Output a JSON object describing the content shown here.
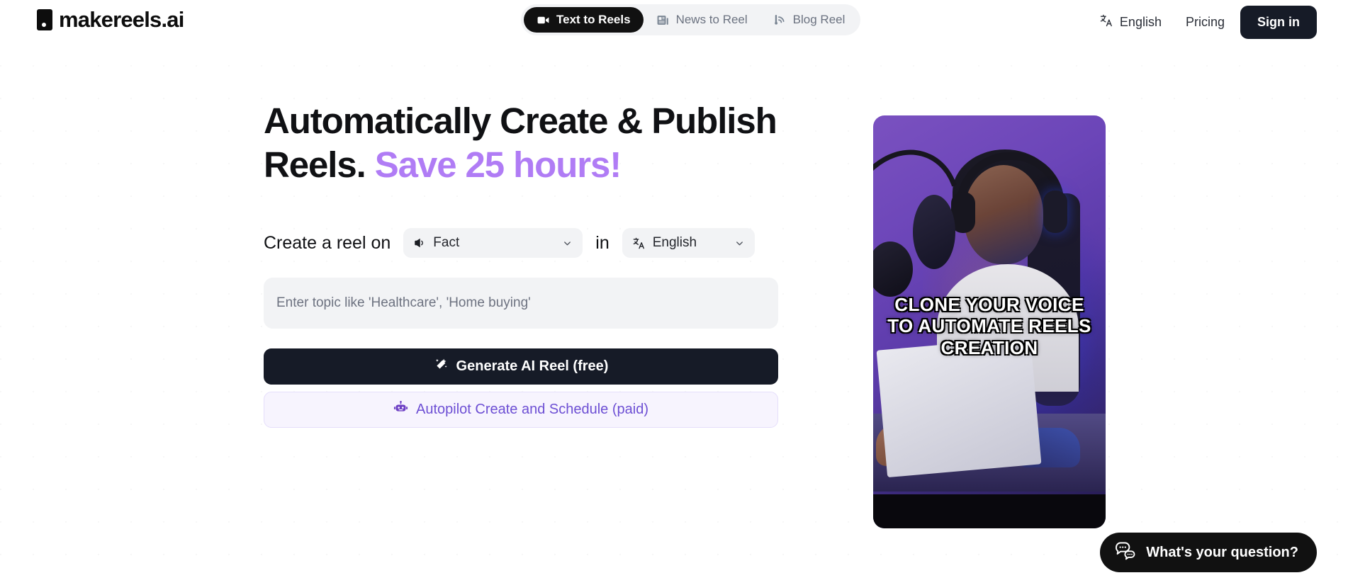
{
  "brand": {
    "name": "makereels.ai",
    "logo_icon": "reel-square-icon"
  },
  "header": {
    "tabs": [
      {
        "label": "Text to Reels",
        "icon": "video-camera-icon",
        "active": true
      },
      {
        "label": "News to Reel",
        "icon": "newspaper-icon",
        "active": false
      },
      {
        "label": "Blog Reel",
        "icon": "blog-rss-icon",
        "active": false
      }
    ],
    "language": {
      "label": "English",
      "icon": "translate-icon"
    },
    "pricing_label": "Pricing",
    "signin_label": "Sign in"
  },
  "hero": {
    "headline_main": "Automatically Create & Publish Reels.",
    "headline_accent": "Save 25 hours!",
    "accent_color": "#b07cf5"
  },
  "composer": {
    "prefix_label": "Create a reel on",
    "joiner_label": "in",
    "topic_select": {
      "value": "Fact",
      "icon": "megaphone-icon",
      "chevron": "chevron-down-icon"
    },
    "language_select": {
      "value": "English",
      "icon": "translate-icon",
      "chevron": "chevron-down-icon"
    },
    "topic_input": {
      "value": "",
      "placeholder": "Enter topic like 'Healthcare', 'Home buying'"
    },
    "primary_button": {
      "label": "Generate AI Reel (free)",
      "icon": "magic-wand-icon"
    },
    "secondary_button": {
      "label": "Autopilot Create and Schedule (paid)",
      "icon": "robot-icon",
      "color": "#6d4fd4"
    }
  },
  "preview": {
    "caption": "CLONE YOUR VOICE TO AUTOMATE REELS CREATION"
  },
  "chat": {
    "label": "What's your question?",
    "icon": "chat-bubbles-icon"
  }
}
